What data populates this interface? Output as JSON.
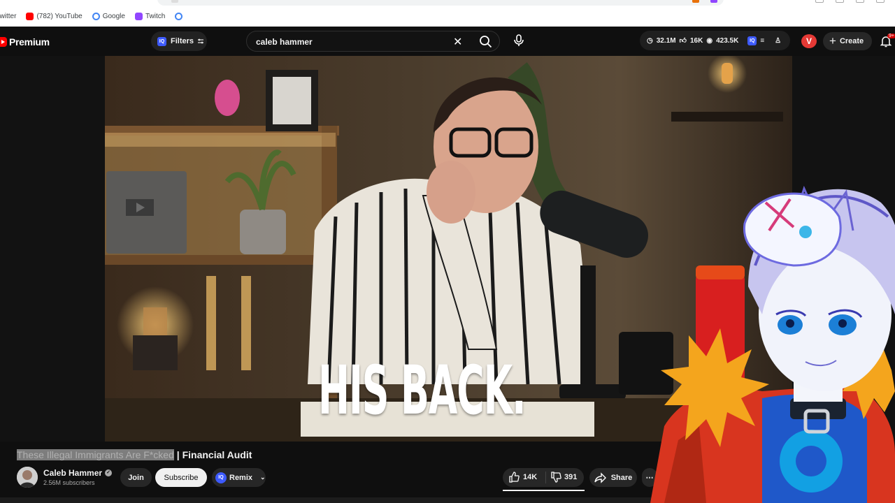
{
  "browser": {
    "bookmarks": [
      {
        "label": "Twitter",
        "icon": "twitter-icon"
      },
      {
        "label": "(782) YouTube",
        "icon": "youtube-icon",
        "color": "#ff0000"
      },
      {
        "label": "Google",
        "icon": "google-icon",
        "color": "#4285f4"
      },
      {
        "label": "Twitch",
        "icon": "twitch-icon",
        "color": "#9146ff"
      }
    ]
  },
  "header": {
    "logo_text": "Premium",
    "filters_label": "Filters",
    "search_value": "caleb hammer",
    "stats": {
      "views": "32.1M",
      "likes": "16K",
      "watching": "423.5K"
    },
    "avatar_letter": "V",
    "create_label": "Create",
    "notification_count": "9+"
  },
  "video": {
    "overlay_text": "HIS BACK.",
    "title_highlight": "These Illegal Immigrants Are F*cked",
    "title_rest": " | Financial Audit"
  },
  "channel": {
    "name": "Caleb Hammer",
    "subscribers": "2.56M subscribers",
    "join_label": "Join",
    "subscribe_label": "Subscribe",
    "remix_label": "Remix"
  },
  "actions": {
    "likes": "14K",
    "dislikes": "391",
    "share_label": "Share"
  },
  "colors": {
    "accent": "#ff0000",
    "background": "#0f0f0f"
  }
}
